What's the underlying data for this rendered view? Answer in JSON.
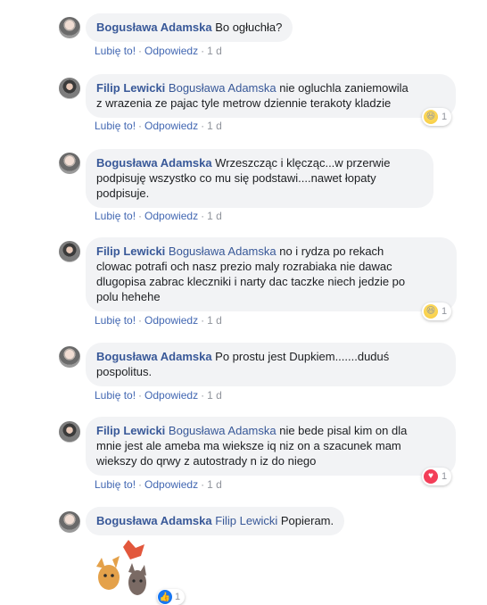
{
  "labels": {
    "like": "Lubię to!",
    "reply": "Odpowiedz",
    "sep": "·"
  },
  "comments": [
    {
      "author": "Bogusława Adamska",
      "tag": "",
      "text": "Bo ogłuchła?",
      "time": "1 d"
    },
    {
      "author": "Filip Lewicki",
      "tag": "Bogusława Adamska",
      "line1": " nie ogluchla zaniemowila",
      "line2": "z wrazenia ze pajac tyle metrow dziennie terakoty kladzie",
      "time": "1 d",
      "reaction": "haha",
      "reaction_count": "1"
    },
    {
      "author": "Bogusława Adamska",
      "tag": "",
      "line1": " Wrzeszcząc i klęcząc...w przerwie",
      "line2": "podpisuję wszystko co mu się podstawi....nawet łopaty",
      "line3": "podpisuje.",
      "time": "1 d"
    },
    {
      "author": "Filip Lewicki",
      "tag": "Bogusława Adamska",
      "line1": " no i rydza po rekach",
      "line2": "clowac potrafi och nasz prezio maly rozrabiaka nie dawac",
      "line3": "dlugopisa zabrac kleczniki i narty dac taczke niech jedzie po",
      "line4": "polu hehehe",
      "time": "1 d",
      "reaction": "haha",
      "reaction_count": "1"
    },
    {
      "author": "Bogusława Adamska",
      "tag": "",
      "line1": " Po prostu jest Dupkiem.......duduś",
      "line2": "pospolitus.",
      "time": "1 d"
    },
    {
      "author": "Filip Lewicki",
      "tag": "Bogusława Adamska",
      "line1": " nie bede pisal kim on dla",
      "line2": "mnie jest ale ameba ma wieksze iq niz on a szacunek mam",
      "line3": "wiekszy do qrwy z autostrady n iz do niego",
      "time": "1 d",
      "reaction": "love",
      "reaction_count": "1"
    },
    {
      "author": "Bogusława Adamska",
      "tag": "Filip Lewicki",
      "text": " Popieram.",
      "sticker_reaction": "like",
      "sticker_count": "1"
    }
  ],
  "icons": {
    "haha": "haha-emoji-icon",
    "love": "love-heart-icon",
    "like": "thumbs-up-icon"
  },
  "colors": {
    "link": "#385898",
    "action": "#4267b2",
    "bubble": "#f2f3f5"
  }
}
